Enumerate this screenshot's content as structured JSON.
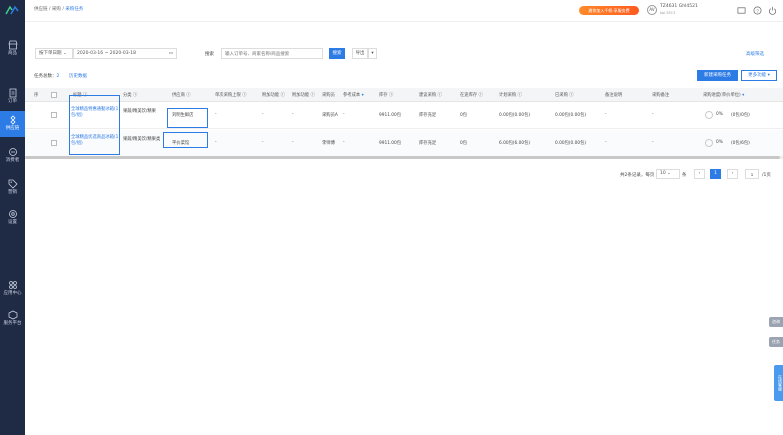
{
  "sidebar": {
    "items": [
      {
        "label": "商品",
        "icon": "shop-icon"
      },
      {
        "label": "订单",
        "icon": "order-icon"
      },
      {
        "label": "供应链",
        "icon": "supply-chain-icon"
      },
      {
        "label": "消费者",
        "icon": "consumer-icon"
      },
      {
        "label": "营销",
        "icon": "tag-icon"
      },
      {
        "label": "设置",
        "icon": "gear-icon"
      },
      {
        "label": "应用中心",
        "icon": "apps-icon"
      },
      {
        "label": "服务平台",
        "icon": "service-icon"
      }
    ]
  },
  "header": {
    "breadcrumb": [
      "供应链",
      "采购",
      "采购任务"
    ],
    "promo": "邀你加入千帆·享服务费",
    "shop_logo": "AV",
    "shop_name": "TZ4631 GhI4521",
    "shop_sub": "kpl.5513"
  },
  "filters": {
    "date_type": "按下单日期",
    "date_range": "2020-03-16 ~ 2020-03-18",
    "search_label": "搜索",
    "search_placeholder": "输入订单号、商家名称/商品搜索",
    "search_button": "搜索",
    "export_button": "导出",
    "advanced_filter": "高级筛选"
  },
  "toolbar": {
    "task_count_label": "任务总数：",
    "task_count": "2",
    "history_link": "历史数据",
    "new_task_button": "新建采购任务",
    "more_button": "更多功能"
  },
  "table": {
    "headers": [
      "序",
      "",
      "标题",
      "分类",
      "供应商",
      "单次采购上限",
      "附加功能",
      "附加功能",
      "采购员",
      "参考成本",
      "库存",
      "建议采购",
      "在途库存",
      "计划采购",
      "已采购",
      "备注说明",
      "采购备注",
      "采购进度(单价单位)"
    ],
    "rows": [
      {
        "name": "全球精品特惠通勤冰箱(1包/组)",
        "category": "果蔬/精美饮/精果",
        "supplier": "刘明生鲜店",
        "limit": "-",
        "extra1": "-",
        "extra2": "-",
        "buyer": "采购员A",
        "cost": "-",
        "stock": "9911.00包",
        "suggest": "库存充足",
        "transit": "0包",
        "plan": "0.00包(0.00包)",
        "bought": "0.00包(0.00包)",
        "remark": "-",
        "note": "-",
        "progress": "0%",
        "progress_detail": "(0包/0包)"
      },
      {
        "name": "全球精品优选商品冰箱(1包/组)",
        "category": "果蔬/精美饮/精果类",
        "supplier": "平价菜馆",
        "limit": "-",
        "extra1": "-",
        "extra2": "-",
        "buyer": "李师傅",
        "cost": "-",
        "stock": "9911.00包",
        "suggest": "库存充足",
        "transit": "0包",
        "plan": "6.00包(6.00包)",
        "bought": "0.00包(0.00包)",
        "remark": "-",
        "note": "-",
        "progress": "0%",
        "progress_detail": "(0包/6包)"
      }
    ]
  },
  "pager": {
    "summary": "共2条记录，每页",
    "per_page": "10",
    "unit": "条",
    "prev": "‹",
    "current": "1",
    "next": "›",
    "goto": "1",
    "total_pages": "/1页"
  },
  "float": {
    "btn1": "咨询",
    "btn2": "任务",
    "btn3": "在线客服"
  },
  "colors": {
    "accent": "#2d7be5",
    "sidebar": "#1f2a44",
    "promo": "#ff5a1f"
  }
}
